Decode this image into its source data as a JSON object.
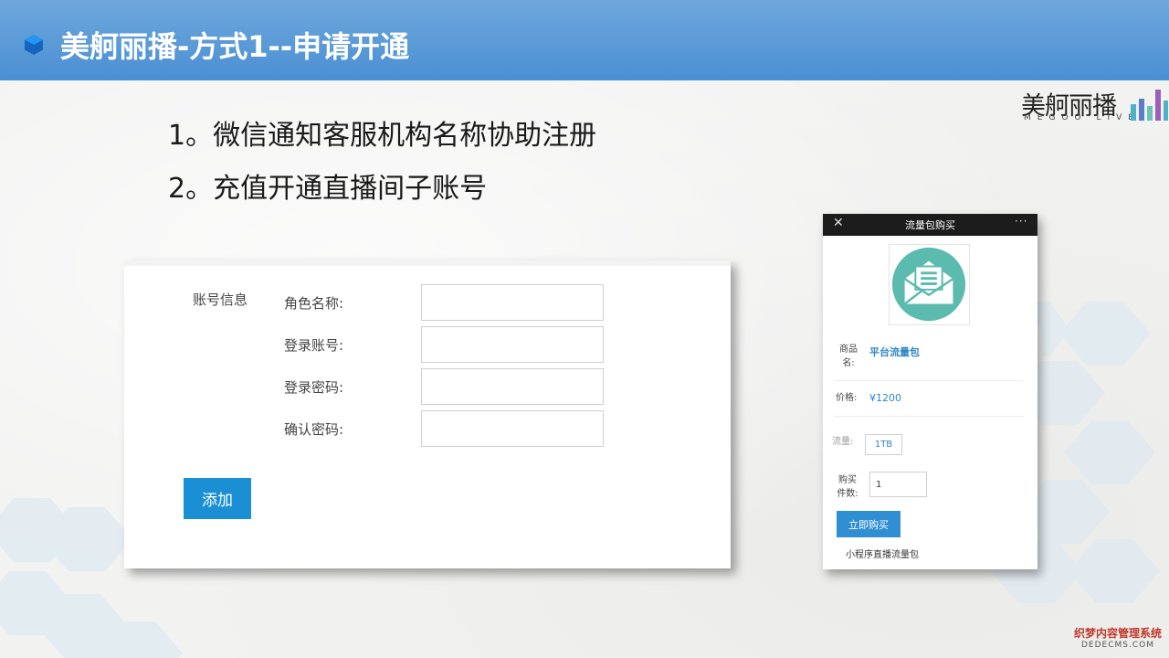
{
  "slide": {
    "title": "美舸丽播-方式1--申请开通",
    "logo": {
      "name": "美舸丽播",
      "sub": "MEGOO LIVE"
    },
    "steps": [
      "1。微信通知客服机构名称协助注册",
      "2。充值开通直播间子账号"
    ]
  },
  "form": {
    "section_label": "账号信息",
    "fields": [
      {
        "label": "角色名称:",
        "value": ""
      },
      {
        "label": "登录账号:",
        "value": ""
      },
      {
        "label": "登录密码:",
        "value": ""
      },
      {
        "label": "确认密码:",
        "value": ""
      }
    ],
    "add_button": "添加"
  },
  "phone": {
    "title": "流量包购买",
    "product_name_label": "商品\n名:",
    "product_name": "平台流量包",
    "price_label": "价格:",
    "price": "¥1200",
    "traffic_label": "流量:",
    "traffic": "1TB",
    "qty_label": "购买\n件数:",
    "qty": "1",
    "buy_button": "立即购买",
    "description": "小程序直播流量包"
  },
  "watermark": {
    "line1": "织梦内容管理系统",
    "line2": "DEDECMS.COM"
  },
  "colors": {
    "header_top": "#6fa8dc",
    "header_bottom": "#4a8fd3",
    "accent_button": "#1b8fd4",
    "link_blue": "#2f86c8",
    "icon_teal": "#5bbbae"
  },
  "icons": {
    "bullet": "hexagon-bullet-icon",
    "close": "close-icon",
    "more": "more-dots-icon",
    "product": "envelope-icon",
    "logo_bars": "bar-chart-logo-icon"
  }
}
